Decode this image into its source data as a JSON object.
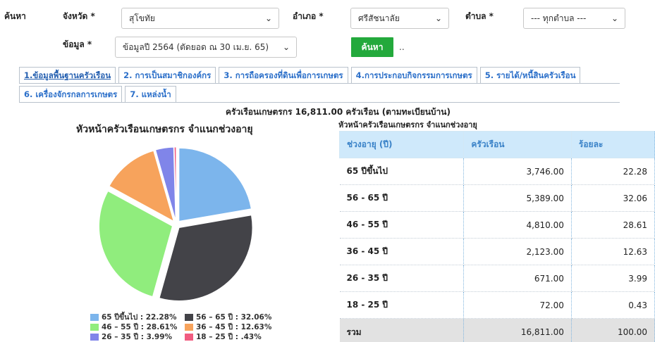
{
  "search": {
    "label": "ค้นหา",
    "province_label": "จังหวัด *",
    "province_value": "สุโขทัย",
    "district_label": "อำเภอ *",
    "district_value": "ศรีสัชนาลัย",
    "subdistrict_label": "ตำบล *",
    "subdistrict_value": "--- ทุกตำบล ---",
    "data_label": "ข้อมูล *",
    "data_value": "ข้อมูลปี 2564 (ตัดยอด ณ 30 เม.ย. 65)",
    "button_label": "ค้นหา",
    "dots": ".."
  },
  "tabs": [
    {
      "label": "1.ข้อมูลพื้นฐานครัวเรือน"
    },
    {
      "label": "2. การเป็นสมาชิกองค์กร"
    },
    {
      "label": "3. การถือครองที่ดินเพื่อการเกษตร"
    },
    {
      "label": "4.การประกอบกิจกรรมการเกษตร"
    },
    {
      "label": "5. รายได้/หนี้สินครัวเรือน"
    },
    {
      "label": "6. เครื่องจักรกลการเกษตร"
    },
    {
      "label": "7. แหล่งน้ำ"
    }
  ],
  "summary": "ครัวเรือนเกษตรกร 16,811.00 ครัวเรือน (ตามทะเบียนบ้าน)",
  "chart_data": {
    "type": "pie",
    "title": "หัวหน้าครัวเรือนเกษตรกร จำแนกช่วงอายุ",
    "categories": [
      "65 ปีขึ้นไป",
      "56 – 65 ปี",
      "46 – 55 ปี",
      "36 – 45 ปี",
      "26 – 35 ปี",
      "18 – 25 ปี"
    ],
    "values": [
      22.28,
      32.06,
      28.61,
      12.63,
      3.99,
      0.43
    ],
    "colors": [
      "#7cb5ec",
      "#434348",
      "#90ed7d",
      "#f7a35c",
      "#8085e9",
      "#f15c80"
    ],
    "legend": [
      "65 ปีขึ้นไป : 22.28%",
      "56 – 65 ปี : 32.06%",
      "46 – 55 ปี : 28.61%",
      "36 – 45 ปี : 12.63%",
      "26 – 35 ปี : 3.99%",
      "18 – 25 ปี : .43%"
    ],
    "legend_position": "bottom"
  },
  "table": {
    "title": "หัวหน้าครัวเรือนเกษตรกร จำแนกช่วงอายุ",
    "headers": [
      "ช่วงอายุ (ปี)",
      "ครัวเรือน",
      "ร้อยละ"
    ],
    "rows": [
      [
        "65 ปีขึ้นไป",
        "3,746.00",
        "22.28"
      ],
      [
        "56 - 65 ปี",
        "5,389.00",
        "32.06"
      ],
      [
        "46 - 55 ปี",
        "4,810.00",
        "28.61"
      ],
      [
        "36 - 45 ปี",
        "2,123.00",
        "12.63"
      ],
      [
        "26 - 35 ปี",
        "671.00",
        "3.99"
      ],
      [
        "18 - 25 ปี",
        "72.00",
        "0.43"
      ]
    ],
    "total": [
      "รวม",
      "16,811.00",
      "100.00"
    ]
  }
}
